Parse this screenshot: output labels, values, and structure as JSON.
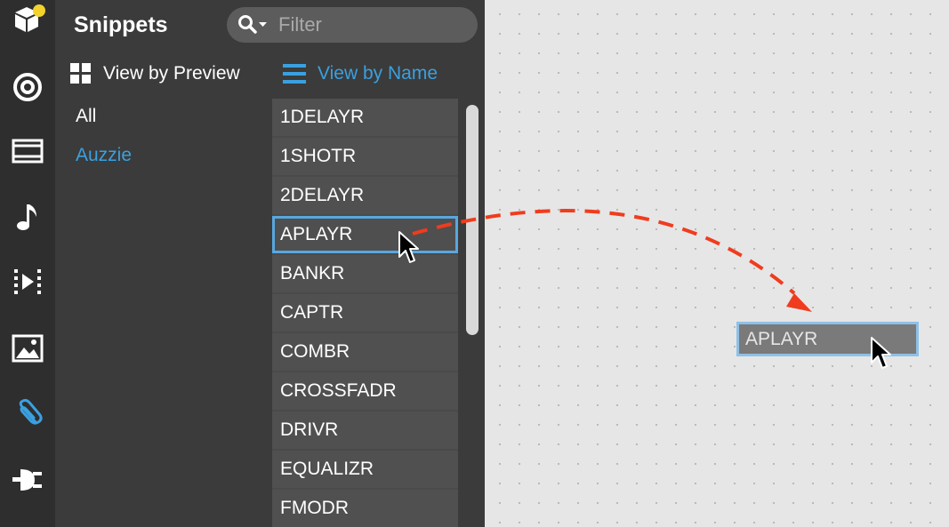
{
  "sidebar": {
    "title": "Snippets",
    "filter": {
      "placeholder": "Filter"
    },
    "views": {
      "preview_label": "View by Preview",
      "name_label": "View by Name"
    },
    "groups": [
      "All",
      "Auzzie"
    ]
  },
  "list": {
    "items": [
      "1DELAYR",
      "1SHOTR",
      "2DELAYR",
      "APLAYR",
      "BANKR",
      "CAPTR",
      "COMBR",
      "CROSSFADR",
      "DRIVR",
      "EQUALIZR",
      "FMODR"
    ],
    "selected": "APLAYR"
  },
  "canvas": {
    "dragged_node_label": "APLAYR"
  },
  "icons": [
    "package-icon",
    "target-icon",
    "film-icon",
    "music-note-icon",
    "video-clip-icon",
    "image-icon",
    "paperclip-icon",
    "plug-icon"
  ],
  "colors": {
    "accent": "#3aa0e0",
    "drag_arrow": "#f03c1e",
    "notification_dot": "#f3d22c"
  }
}
